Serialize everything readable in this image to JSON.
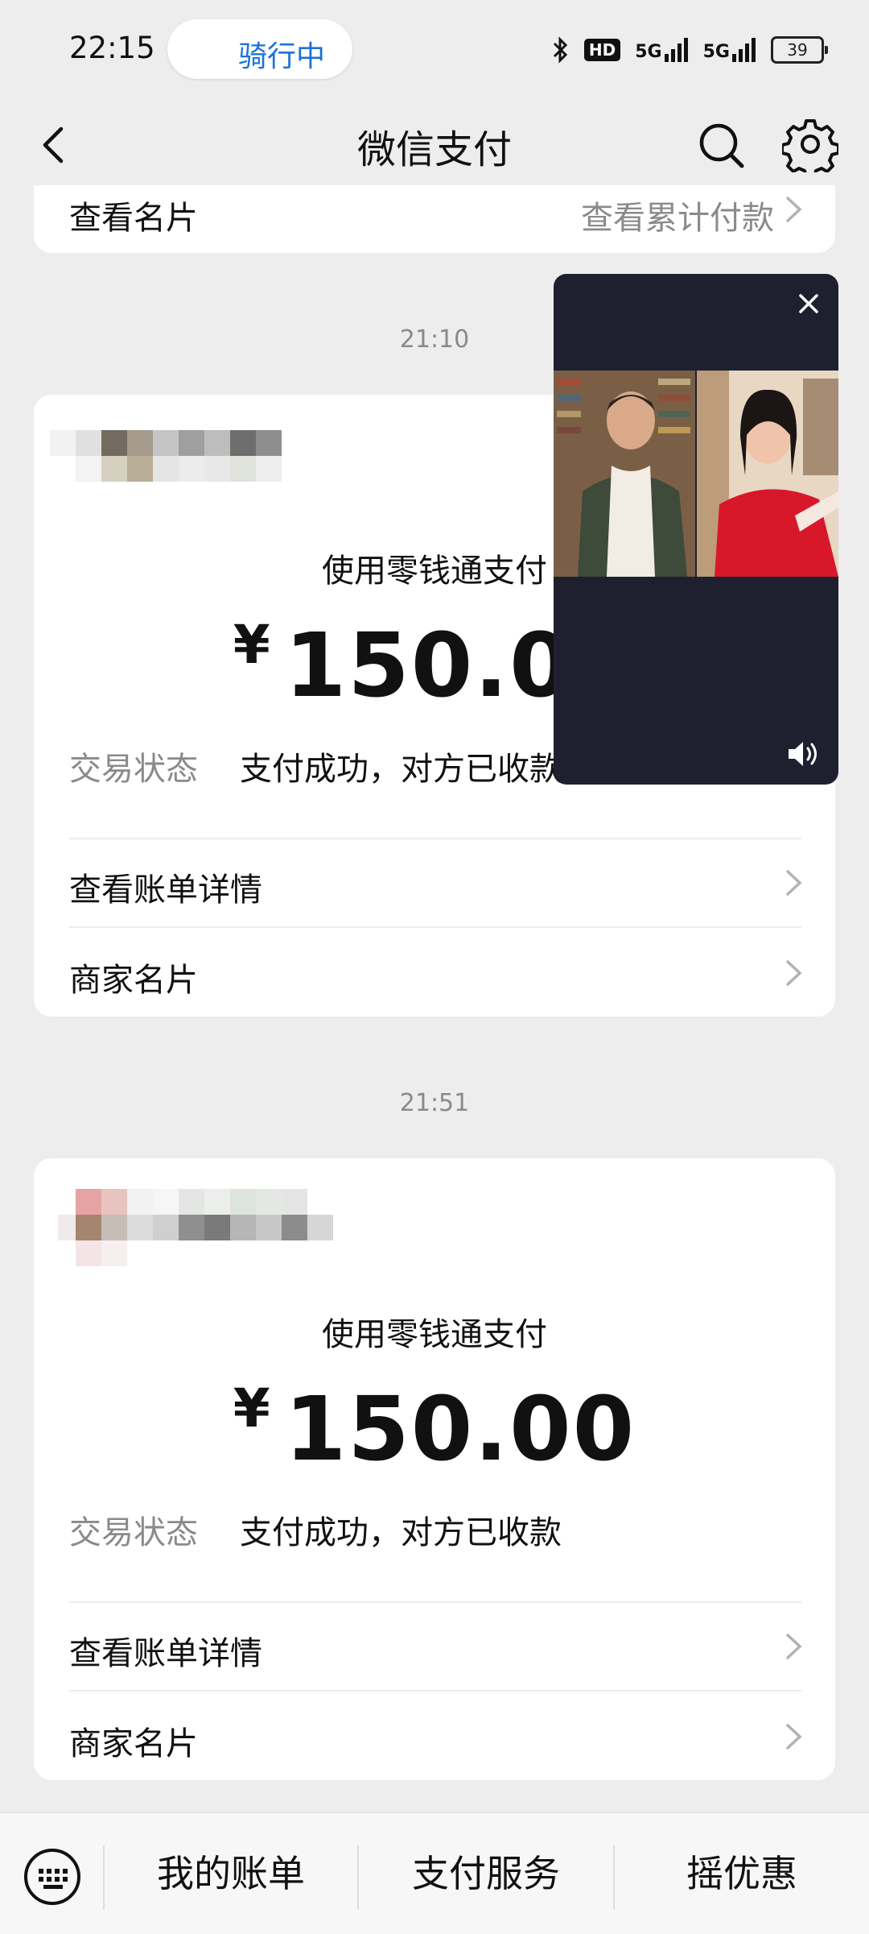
{
  "status_bar": {
    "time": "22:15",
    "pill_text": "骑行中",
    "battery": "39",
    "hd": "HD",
    "net1": "5G",
    "net2": "5G"
  },
  "nav": {
    "title": "微信支付"
  },
  "top_card": {
    "left_label": "查看名片",
    "right_label": "查看累计付款"
  },
  "transactions": [
    {
      "time": "21:10",
      "pay_method": "使用零钱通支付",
      "currency": "¥",
      "amount": "150.00",
      "status_label": "交易状态",
      "status_value": "支付成功，对方已收款",
      "bill_link": "查看账单详情",
      "merchant_link": "商家名片"
    },
    {
      "time": "21:51",
      "pay_method": "使用零钱通支付",
      "currency": "¥",
      "amount": "150.00",
      "status_label": "交易状态",
      "status_value": "支付成功，对方已收款",
      "bill_link": "查看账单详情",
      "merchant_link": "商家名片"
    }
  ],
  "bottom_bar": {
    "tab1": "我的账单",
    "tab2": "支付服务",
    "tab3": "摇优惠"
  },
  "colors": {
    "accent_blue": "#1a73d8",
    "background": "#ededed",
    "video_bg": "#1e2030"
  }
}
